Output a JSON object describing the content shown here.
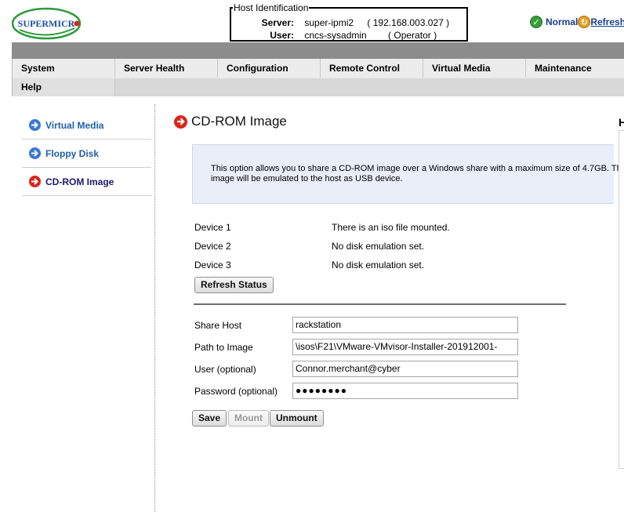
{
  "logo": {
    "text": "SUPERMICRO",
    "brand_color": "#1c4fa0",
    "accent_color": "#2e9a3b"
  },
  "host": {
    "legend": "Host Identification",
    "server_label": "Server:",
    "server_name": "super-ipmi2",
    "server_ip": "( 192.168.003.027 )",
    "user_label": "User:",
    "user_name": "cncs-sysadmin",
    "user_role": "( Operator )"
  },
  "status": {
    "icon": "checkmark-icon",
    "text": "Normal",
    "refresh_icon": "refresh-icon",
    "refresh_label": "Refresh"
  },
  "menu": {
    "items": [
      "System",
      "Server Health",
      "Configuration",
      "Remote Control",
      "Virtual Media",
      "Maintenance"
    ],
    "row2": [
      "Help"
    ]
  },
  "sidebar": {
    "items": [
      {
        "label": "Virtual Media",
        "icon": "arrow-right-icon",
        "color": "#3a78d4"
      },
      {
        "label": "Floppy Disk",
        "icon": "arrow-right-icon",
        "color": "#3a78d4"
      },
      {
        "label": "CD-ROM Image",
        "icon": "arrow-right-icon",
        "color": "#d9261c"
      }
    ]
  },
  "main": {
    "title": "CD-ROM Image",
    "help_edge": "H",
    "info_line1": "This option allows you to share a CD-ROM image over a Windows share with a maximum size of 4.7GB. Th",
    "info_line2": "image will be emulated to the host as USB device.",
    "devices": [
      {
        "label": "Device 1",
        "status": "There is an iso file mounted."
      },
      {
        "label": "Device 2",
        "status": "No disk emulation set."
      },
      {
        "label": "Device 3",
        "status": "No disk emulation set."
      }
    ],
    "refresh_status_label": "Refresh Status",
    "form": {
      "share_host_label": "Share Host",
      "share_host_value": "rackstation",
      "path_label": "Path to Image",
      "path_value": "\\isos\\F21\\VMware-VMvisor-Installer-201912001-",
      "user_label": "User (optional)",
      "user_value": "Connor.merchant@cyber",
      "password_label": "Password (optional)",
      "password_value": "●●●●●●●●"
    },
    "buttons": {
      "save": "Save",
      "mount": "Mount",
      "unmount": "Unmount"
    }
  }
}
